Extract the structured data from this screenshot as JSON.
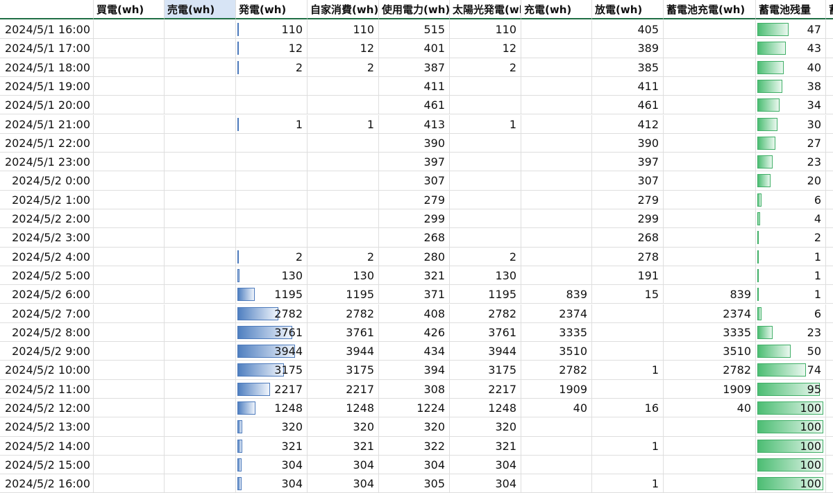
{
  "sheet": {
    "columns": [
      {
        "key": "datetime",
        "label": ""
      },
      {
        "key": "buy",
        "label": "買電(wh)"
      },
      {
        "key": "sell",
        "label": "売電(wh)"
      },
      {
        "key": "gen",
        "label": "発電(wh)"
      },
      {
        "key": "self",
        "label": "自家消費(wh)"
      },
      {
        "key": "use",
        "label": "使用電力(wh)"
      },
      {
        "key": "solar",
        "label": "太陽光発電(wh)"
      },
      {
        "key": "charge",
        "label": "充電(wh)"
      },
      {
        "key": "discharge",
        "label": "放電(wh)"
      },
      {
        "key": "batt_charge",
        "label": "蓄電池充電(wh)"
      },
      {
        "key": "batt_level",
        "label": "蓄電池残量"
      },
      {
        "key": "next",
        "label": "蓄"
      }
    ],
    "selected_column": "sell",
    "gen_bar_max": 4500,
    "level_bar_max": 100,
    "colors": {
      "grid": "#dedede",
      "header_rule": "#1f6e43",
      "selected_header": "#d7e4f5",
      "gen_bar": "#4f7fc0",
      "level_bar": "#4cbd73"
    },
    "rows": [
      {
        "datetime": "2024/5/1 16:00",
        "buy": "",
        "sell": "",
        "gen": "110",
        "self": "110",
        "use": "515",
        "solar": "110",
        "charge": "",
        "discharge": "405",
        "batt_charge": "",
        "batt_level": "47"
      },
      {
        "datetime": "2024/5/1 17:00",
        "buy": "",
        "sell": "",
        "gen": "12",
        "self": "12",
        "use": "401",
        "solar": "12",
        "charge": "",
        "discharge": "389",
        "batt_charge": "",
        "batt_level": "43"
      },
      {
        "datetime": "2024/5/1 18:00",
        "buy": "",
        "sell": "",
        "gen": "2",
        "self": "2",
        "use": "387",
        "solar": "2",
        "charge": "",
        "discharge": "385",
        "batt_charge": "",
        "batt_level": "40"
      },
      {
        "datetime": "2024/5/1 19:00",
        "buy": "",
        "sell": "",
        "gen": "",
        "self": "",
        "use": "411",
        "solar": "",
        "charge": "",
        "discharge": "411",
        "batt_charge": "",
        "batt_level": "38"
      },
      {
        "datetime": "2024/5/1 20:00",
        "buy": "",
        "sell": "",
        "gen": "",
        "self": "",
        "use": "461",
        "solar": "",
        "charge": "",
        "discharge": "461",
        "batt_charge": "",
        "batt_level": "34"
      },
      {
        "datetime": "2024/5/1 21:00",
        "buy": "",
        "sell": "",
        "gen": "1",
        "self": "1",
        "use": "413",
        "solar": "1",
        "charge": "",
        "discharge": "412",
        "batt_charge": "",
        "batt_level": "30"
      },
      {
        "datetime": "2024/5/1 22:00",
        "buy": "",
        "sell": "",
        "gen": "",
        "self": "",
        "use": "390",
        "solar": "",
        "charge": "",
        "discharge": "390",
        "batt_charge": "",
        "batt_level": "27"
      },
      {
        "datetime": "2024/5/1 23:00",
        "buy": "",
        "sell": "",
        "gen": "",
        "self": "",
        "use": "397",
        "solar": "",
        "charge": "",
        "discharge": "397",
        "batt_charge": "",
        "batt_level": "23"
      },
      {
        "datetime": "2024/5/2 0:00",
        "buy": "",
        "sell": "",
        "gen": "",
        "self": "",
        "use": "307",
        "solar": "",
        "charge": "",
        "discharge": "307",
        "batt_charge": "",
        "batt_level": "20"
      },
      {
        "datetime": "2024/5/2 1:00",
        "buy": "",
        "sell": "",
        "gen": "",
        "self": "",
        "use": "279",
        "solar": "",
        "charge": "",
        "discharge": "279",
        "batt_charge": "",
        "batt_level": "6"
      },
      {
        "datetime": "2024/5/2 2:00",
        "buy": "",
        "sell": "",
        "gen": "",
        "self": "",
        "use": "299",
        "solar": "",
        "charge": "",
        "discharge": "299",
        "batt_charge": "",
        "batt_level": "4"
      },
      {
        "datetime": "2024/5/2 3:00",
        "buy": "",
        "sell": "",
        "gen": "",
        "self": "",
        "use": "268",
        "solar": "",
        "charge": "",
        "discharge": "268",
        "batt_charge": "",
        "batt_level": "2"
      },
      {
        "datetime": "2024/5/2 4:00",
        "buy": "",
        "sell": "",
        "gen": "2",
        "self": "2",
        "use": "280",
        "solar": "2",
        "charge": "",
        "discharge": "278",
        "batt_charge": "",
        "batt_level": "1"
      },
      {
        "datetime": "2024/5/2 5:00",
        "buy": "",
        "sell": "",
        "gen": "130",
        "self": "130",
        "use": "321",
        "solar": "130",
        "charge": "",
        "discharge": "191",
        "batt_charge": "",
        "batt_level": "1"
      },
      {
        "datetime": "2024/5/2 6:00",
        "buy": "",
        "sell": "",
        "gen": "1195",
        "self": "1195",
        "use": "371",
        "solar": "1195",
        "charge": "839",
        "discharge": "15",
        "batt_charge": "839",
        "batt_level": "1"
      },
      {
        "datetime": "2024/5/2 7:00",
        "buy": "",
        "sell": "",
        "gen": "2782",
        "self": "2782",
        "use": "408",
        "solar": "2782",
        "charge": "2374",
        "discharge": "",
        "batt_charge": "2374",
        "batt_level": "6"
      },
      {
        "datetime": "2024/5/2 8:00",
        "buy": "",
        "sell": "",
        "gen": "3761",
        "self": "3761",
        "use": "426",
        "solar": "3761",
        "charge": "3335",
        "discharge": "",
        "batt_charge": "3335",
        "batt_level": "23"
      },
      {
        "datetime": "2024/5/2 9:00",
        "buy": "",
        "sell": "",
        "gen": "3944",
        "self": "3944",
        "use": "434",
        "solar": "3944",
        "charge": "3510",
        "discharge": "",
        "batt_charge": "3510",
        "batt_level": "50"
      },
      {
        "datetime": "2024/5/2 10:00",
        "buy": "",
        "sell": "",
        "gen": "3175",
        "self": "3175",
        "use": "394",
        "solar": "3175",
        "charge": "2782",
        "discharge": "1",
        "batt_charge": "2782",
        "batt_level": "74"
      },
      {
        "datetime": "2024/5/2 11:00",
        "buy": "",
        "sell": "",
        "gen": "2217",
        "self": "2217",
        "use": "308",
        "solar": "2217",
        "charge": "1909",
        "discharge": "",
        "batt_charge": "1909",
        "batt_level": "95"
      },
      {
        "datetime": "2024/5/2 12:00",
        "buy": "",
        "sell": "",
        "gen": "1248",
        "self": "1248",
        "use": "1224",
        "solar": "1248",
        "charge": "40",
        "discharge": "16",
        "batt_charge": "40",
        "batt_level": "100"
      },
      {
        "datetime": "2024/5/2 13:00",
        "buy": "",
        "sell": "",
        "gen": "320",
        "self": "320",
        "use": "320",
        "solar": "320",
        "charge": "",
        "discharge": "",
        "batt_charge": "",
        "batt_level": "100"
      },
      {
        "datetime": "2024/5/2 14:00",
        "buy": "",
        "sell": "",
        "gen": "321",
        "self": "321",
        "use": "322",
        "solar": "321",
        "charge": "",
        "discharge": "1",
        "batt_charge": "",
        "batt_level": "100"
      },
      {
        "datetime": "2024/5/2 15:00",
        "buy": "",
        "sell": "",
        "gen": "304",
        "self": "304",
        "use": "304",
        "solar": "304",
        "charge": "",
        "discharge": "",
        "batt_charge": "",
        "batt_level": "100"
      },
      {
        "datetime": "2024/5/2 16:00",
        "buy": "",
        "sell": "",
        "gen": "304",
        "self": "304",
        "use": "305",
        "solar": "304",
        "charge": "",
        "discharge": "1",
        "batt_charge": "",
        "batt_level": "100"
      }
    ]
  }
}
